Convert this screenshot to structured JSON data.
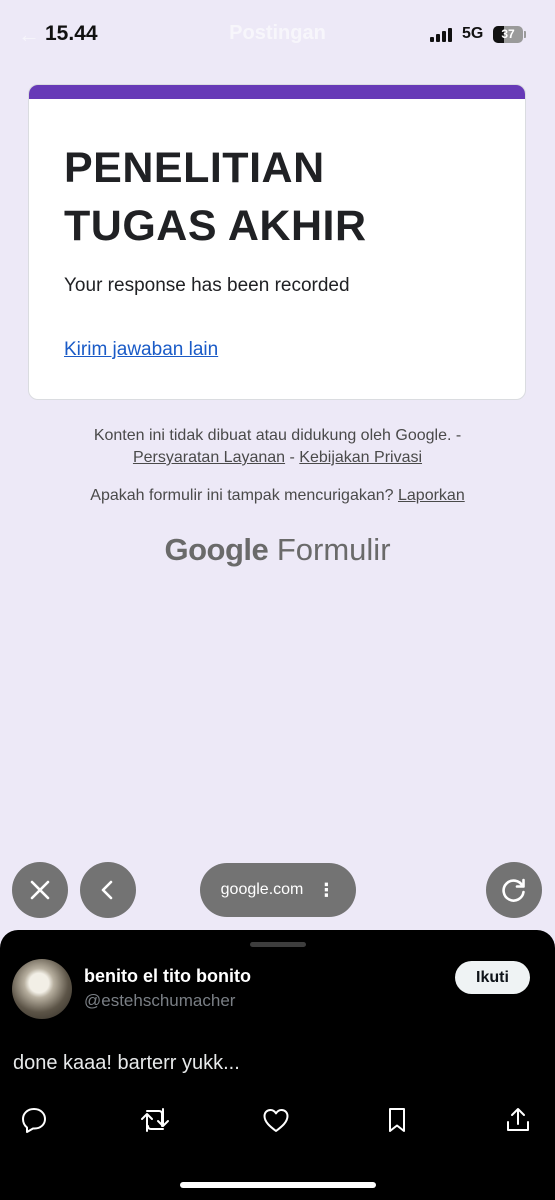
{
  "status_bar": {
    "time": "15.44",
    "network": "5G",
    "battery": "37",
    "underlay_title": "Postingan"
  },
  "form": {
    "title_line1": "PENELITIAN",
    "title_line2": "TUGAS AKHIR",
    "confirmation": "Your response has been recorded",
    "submit_another": "Kirim jawaban lain",
    "accent_color": "#673ab7"
  },
  "footer": {
    "disclaimer": "Konten ini tidak dibuat atau didukung oleh Google. -",
    "terms": "Persyaratan Layanan",
    "separator": "-",
    "privacy": "Kebijakan Privasi",
    "suspicious": "Apakah formulir ini tampak mencurigakan?",
    "report": "Laporkan",
    "logo_google": "Google",
    "logo_product": "Formulir"
  },
  "browser": {
    "url": "google.com",
    "close_icon": "close-icon",
    "back_icon": "chevron-left-icon",
    "reload_icon": "reload-icon"
  },
  "tweet": {
    "display_name": "benito el tito bonito",
    "handle": "@estehschumacher",
    "follow_label": "Ikuti",
    "text": "done kaaa! barterr yukk...",
    "actions": [
      "reply-icon",
      "retweet-icon",
      "like-icon",
      "bookmark-icon",
      "share-icon"
    ]
  }
}
